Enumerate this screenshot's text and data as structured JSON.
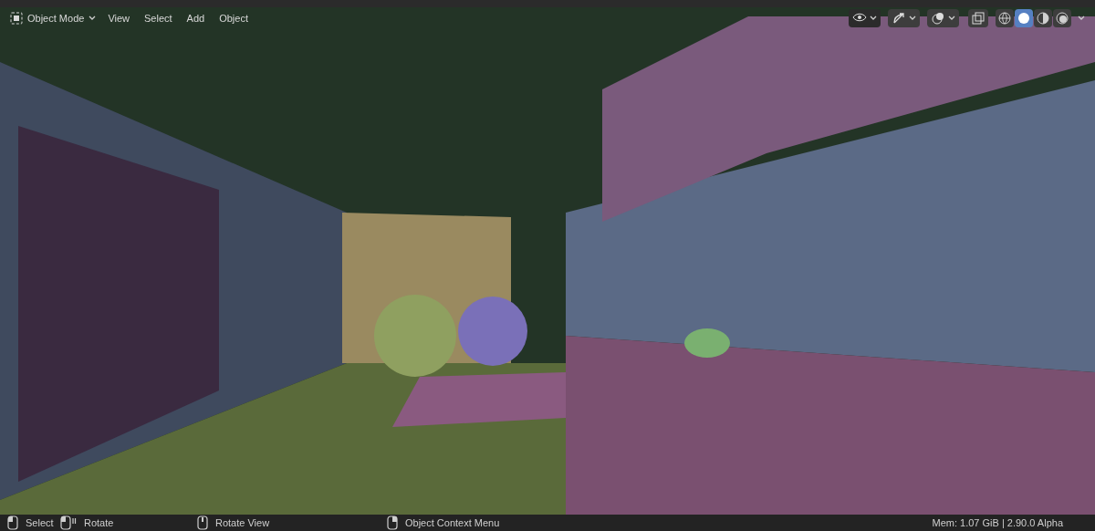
{
  "header": {
    "mode": "Object Mode",
    "menus": [
      "View",
      "Select",
      "Add",
      "Object"
    ]
  },
  "shading_modes": [
    {
      "kind": "wireframe",
      "selected": false
    },
    {
      "kind": "solid",
      "selected": true
    },
    {
      "kind": "material",
      "selected": false
    },
    {
      "kind": "rendered",
      "selected": false
    }
  ],
  "status_bar": {
    "hints": [
      {
        "kind": "left",
        "label": "Select"
      },
      {
        "kind": "drag",
        "label": "Rotate"
      },
      {
        "kind": "middle",
        "label": "Rotate View"
      },
      {
        "kind": "right",
        "label": "Object Context Menu"
      }
    ],
    "info": "Mem: 1.07 GiB | 2.90.0 Alpha"
  }
}
